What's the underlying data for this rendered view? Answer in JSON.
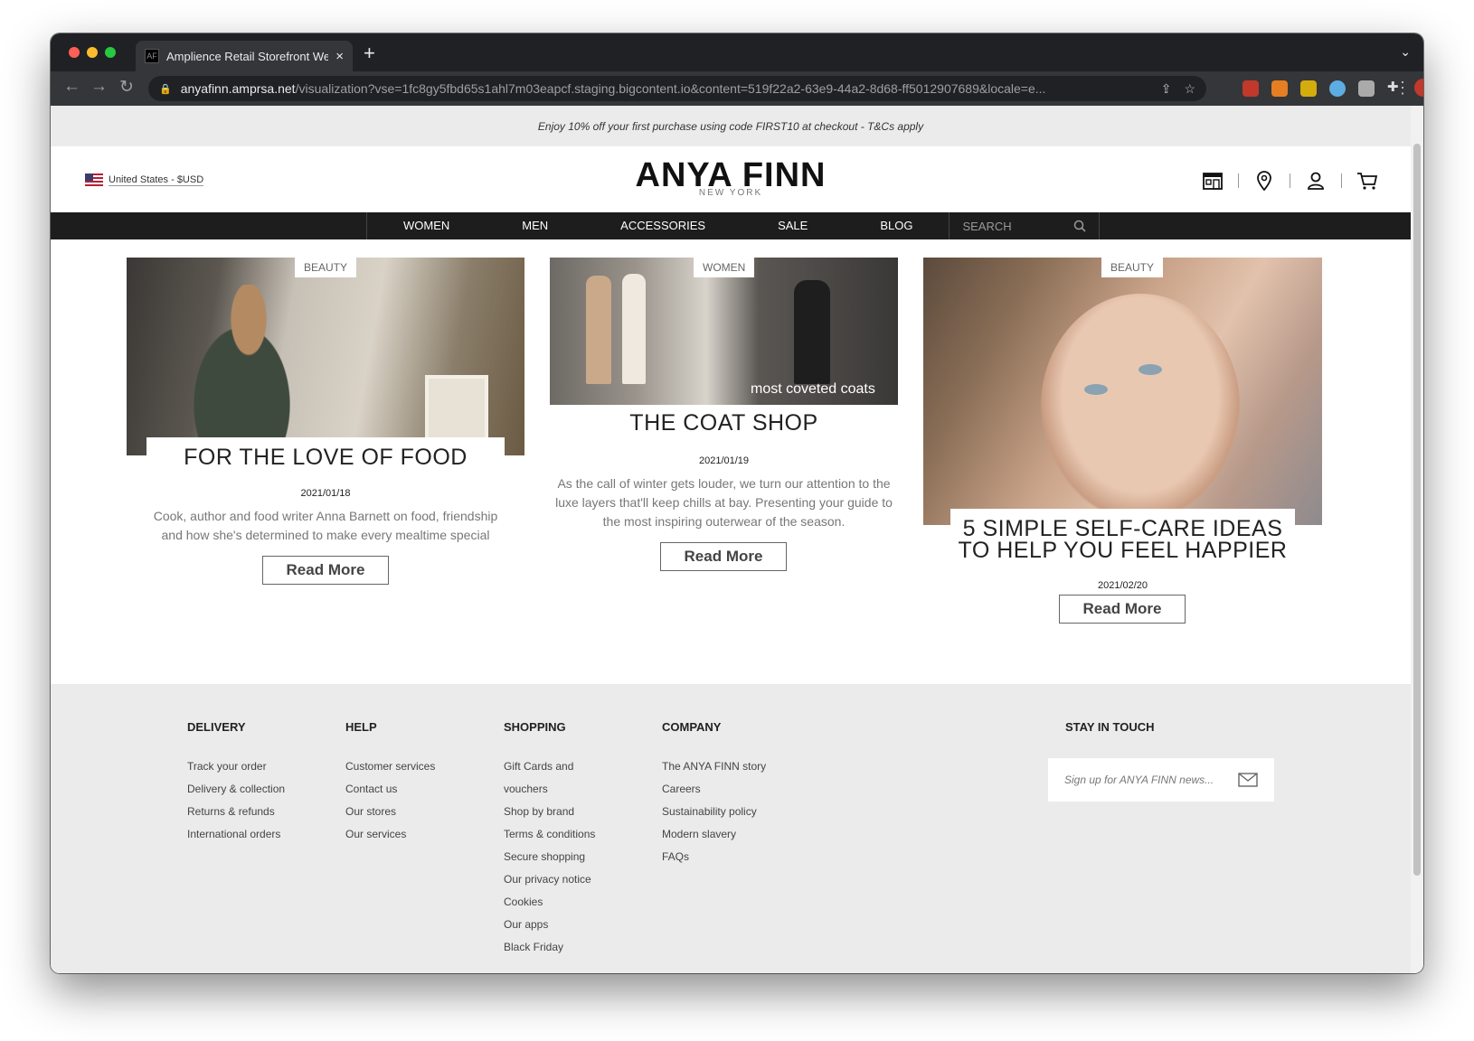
{
  "browser": {
    "tab_title": "Amplience Retail Storefront We",
    "tab_favicon": "AF",
    "url_host": "anyafinn.amprsa.net",
    "url_path": "/visualization?vse=1fc8gy5fbd65s1ahl7m03eapcf.staging.bigcontent.io&content=519f22a2-63e9-44a2-8d68-ff5012907689&locale=e..."
  },
  "promo": {
    "text": "Enjoy 10% off your first purchase using code FIRST10 at checkout - T&Cs apply"
  },
  "header": {
    "locale": "United States - $USD",
    "logo_main": "ANYA FINN",
    "logo_sub": "NEW YORK"
  },
  "nav": {
    "items": [
      "WOMEN",
      "MEN",
      "ACCESSORIES",
      "SALE",
      "BLOG"
    ],
    "search_placeholder": "SEARCH"
  },
  "articles": [
    {
      "tag": "BEAUTY",
      "title": "FOR THE LOVE OF FOOD",
      "date": "2021/01/18",
      "desc": "Cook, author and food writer Anna Barnett on food, friendship and how she's determined to make every mealtime special",
      "button": "Read More"
    },
    {
      "tag": "WOMEN",
      "title": "THE COAT SHOP",
      "date": "2021/01/19",
      "desc": "As the call of winter gets louder, we turn our attention to the luxe layers that'll keep chills at bay. Presenting your guide to the most inspiring outerwear of the season.",
      "button": "Read More",
      "image_caption": "most coveted coats"
    },
    {
      "tag": "BEAUTY",
      "title": "5 SIMPLE SELF-CARE IDEAS TO HELP YOU FEEL HAPPIER",
      "date": "2021/02/20",
      "button": "Read More"
    }
  ],
  "footer": {
    "delivery": {
      "heading": "DELIVERY",
      "links": [
        "Track your order",
        "Delivery & collection",
        "Returns & refunds",
        "International orders"
      ]
    },
    "help": {
      "heading": "HELP",
      "links": [
        "Customer services",
        "Contact us",
        "Our stores",
        "Our services"
      ]
    },
    "shopping": {
      "heading": "SHOPPING",
      "links": [
        "Gift Cards and",
        "vouchers",
        "Shop by brand",
        "Terms & conditions",
        "Secure shopping",
        "Our privacy notice",
        "Cookies",
        "Our apps",
        "Black Friday"
      ]
    },
    "company": {
      "heading": "COMPANY",
      "links": [
        "The ANYA FINN story",
        "Careers",
        "Sustainability policy",
        "Modern slavery",
        "FAQs"
      ]
    },
    "newsletter": {
      "heading": "STAY IN TOUCH",
      "placeholder": "Sign up for ANYA FINN news..."
    }
  }
}
